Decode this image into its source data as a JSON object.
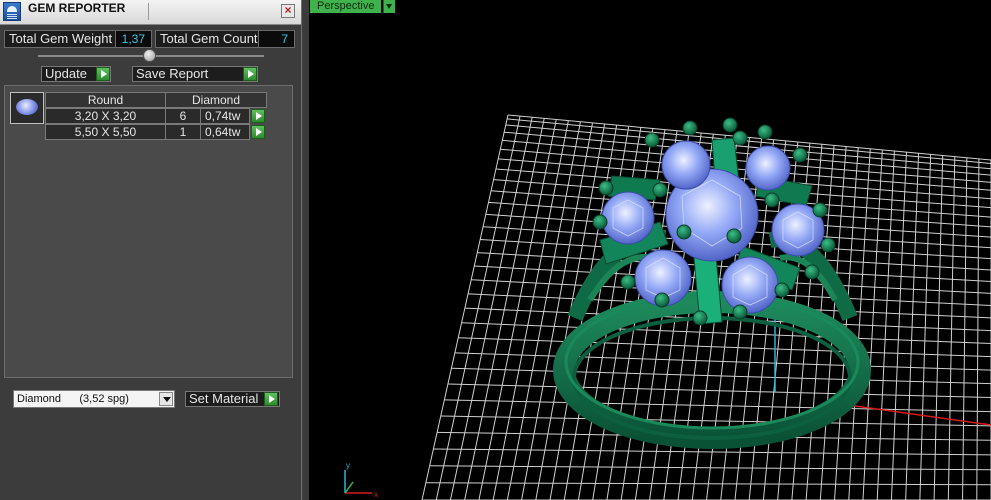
{
  "panel": {
    "title": "GEM REPORTER",
    "close_glyph": "×",
    "total_weight_label": "Total Gem Weight",
    "total_weight_value": "1,37",
    "total_count_label": "Total Gem Count",
    "total_count_value": "7",
    "update_label": "Update",
    "save_label": "Save Report",
    "table": {
      "headers": [
        "Round",
        "Diamond"
      ],
      "rows": [
        {
          "size": "3,20 X 3,20",
          "count": "6",
          "weight": "0,74tw"
        },
        {
          "size": "5,50 X 5,50",
          "count": "1",
          "weight": "0,64tw"
        }
      ]
    },
    "material_select": "Diamond      (3,52 spg)",
    "set_material_label": "Set Material"
  },
  "viewport": {
    "view_label": "Perspective"
  },
  "colors": {
    "panel_bg": "#3c3c3c",
    "accent_green": "#3fb24d",
    "value_cyan": "#36c8e8",
    "ring_green": "#0e6b45",
    "gem_blue": "#8fa6f5",
    "grid": "#cfcfcf"
  }
}
